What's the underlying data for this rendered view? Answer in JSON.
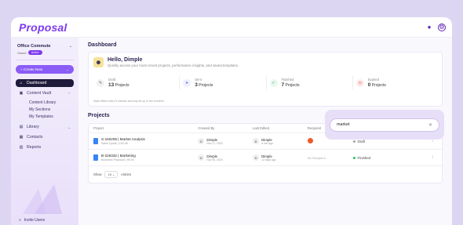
{
  "app": {
    "logo": "Proposal"
  },
  "sidebar": {
    "org_name": "Office Commute",
    "org_owner": "Owner",
    "org_badge": "Active",
    "create_label": "+ Create New",
    "nav": [
      {
        "label": "Dashboard",
        "icon": "home-icon",
        "glyph": "⌂"
      },
      {
        "label": "Content Vault",
        "icon": "vault-icon",
        "glyph": "▣"
      },
      {
        "label": "Library",
        "icon": "library-icon",
        "glyph": "▤"
      },
      {
        "label": "Contacts",
        "icon": "contacts-icon",
        "glyph": "▦"
      },
      {
        "label": "Reports",
        "icon": "reports-icon",
        "glyph": "▥"
      }
    ],
    "sub_items": [
      "Content Library",
      "My Sections",
      "My Templates"
    ],
    "invite": "Invite Users"
  },
  "main": {
    "page_title": "Dashboard",
    "hello": "Hello, Dimple",
    "hello_sub": "Quickly access your most recent projects, performance insights, and saved templates.",
    "stats": [
      {
        "label": "Draft",
        "count": "13",
        "unit": "Projects",
        "icon": "pencil-icon",
        "glyph": "✎",
        "bg": "#f1f1f4",
        "fg": "#555"
      },
      {
        "label": "Sent",
        "count": "3",
        "unit": "Projects",
        "icon": "send-icon",
        "glyph": "➤",
        "bg": "#eef0ff",
        "fg": "#5b6cf0"
      },
      {
        "label": "Finished",
        "count": "7",
        "unit": "Projects",
        "icon": "check-icon",
        "glyph": "✓",
        "bg": "#e8f7ee",
        "fg": "#22a35a"
      },
      {
        "label": "Expired",
        "count": "0",
        "unit": "Projects",
        "icon": "clock-icon",
        "glyph": "◷",
        "bg": "#fdecec",
        "fg": "#e0524b"
      }
    ],
    "note": "Stats reflect every 5 minutes and may be up to five hundred",
    "projects_title": "Projects",
    "columns": [
      "Project",
      "Created By",
      "Last Edited",
      "Recipient",
      "Status"
    ],
    "rows": [
      {
        "name": "S-150208 | Market Analysis",
        "sub": "Sales Quote | 153.06",
        "created_initial": "D",
        "created_name": "Dimple",
        "created_date": "Nov 17, 2020",
        "edited_initial": "D",
        "edited_name": "Dimple",
        "edited_date": "a min ago",
        "recipient": "",
        "status": "Draft",
        "status_color": "#9ca3af"
      },
      {
        "name": "B-225332 | Marketing",
        "sub": "Business Proposal | 99.00",
        "created_initial": "D",
        "created_name": "Dimple",
        "created_date": "Nov 06, 2020",
        "edited_initial": "D",
        "edited_name": "Dimple",
        "edited_date": "12 days ago",
        "recipient": "No Recipient",
        "status": "Finished",
        "status_color": "#22c55e"
      }
    ],
    "show_label": "Show",
    "show_value": "15",
    "entries_label": "entries"
  },
  "search": {
    "value": "market"
  }
}
